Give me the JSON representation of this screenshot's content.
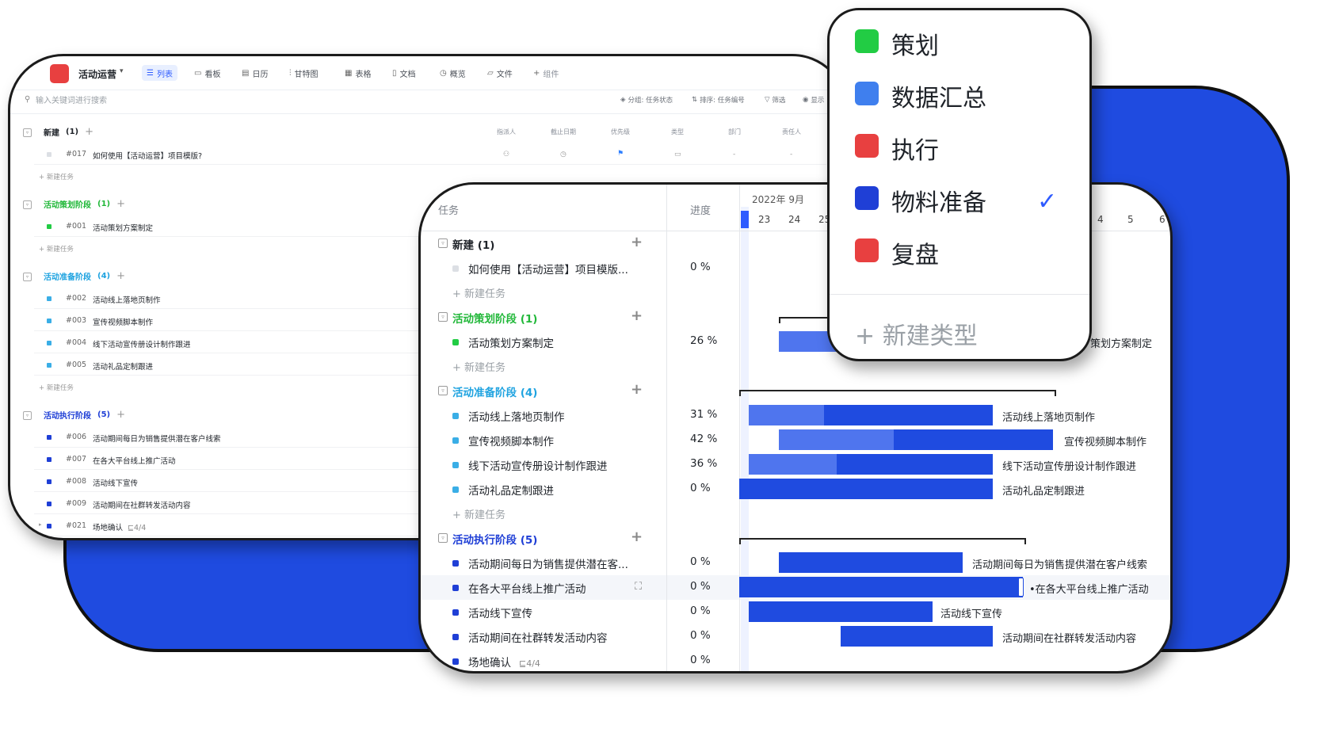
{
  "colors": {
    "brand_blue": "#1f4be0",
    "accent": "#2e5bff",
    "green": "#22cc44",
    "red": "#e84040",
    "light_blue": "#3f7fee",
    "cyan": "#3aaee6",
    "navy": "#1f3fd6"
  },
  "list_window": {
    "app_name": "活动运营",
    "tabs": [
      {
        "icon": "list-icon",
        "label": "列表"
      },
      {
        "icon": "kanban-icon",
        "label": "看板"
      },
      {
        "icon": "calendar-icon",
        "label": "日历"
      },
      {
        "icon": "gantt-icon",
        "label": "甘特图"
      },
      {
        "icon": "table-icon",
        "label": "表格"
      },
      {
        "icon": "doc-icon",
        "label": "文档"
      },
      {
        "icon": "overview-icon",
        "label": "概览"
      },
      {
        "icon": "folder-icon",
        "label": "文件"
      },
      {
        "icon": "plus-icon",
        "label": "组件"
      }
    ],
    "search_placeholder": "输入关键词进行搜索",
    "options": {
      "group": "分组: 任务状态",
      "sort": "排序: 任务编号",
      "filter": "筛选",
      "display": "显示"
    },
    "columns": [
      "指派人",
      "截止日期",
      "优先级",
      "类型",
      "部门",
      "责任人"
    ],
    "new_task_label": "新建任务",
    "groups": [
      {
        "name": "新建",
        "count": "(1)",
        "color": "#1f2329",
        "tasks": [
          {
            "id": "#017",
            "title": "如何使用【活动运营】项目模版?",
            "color": "#dcdfe4",
            "dept": "-",
            "owner": "-"
          }
        ]
      },
      {
        "name": "活动策划阶段",
        "count": "(1)",
        "color": "#22b83a",
        "tasks": [
          {
            "id": "#001",
            "title": "活动策划方案制定",
            "color": "#22cc44"
          }
        ]
      },
      {
        "name": "活动准备阶段",
        "count": "(4)",
        "color": "#1fa3e0",
        "tasks": [
          {
            "id": "#002",
            "title": "活动线上落地页制作",
            "color": "#3aaee6"
          },
          {
            "id": "#003",
            "title": "宣传视频脚本制作",
            "color": "#3aaee6"
          },
          {
            "id": "#004",
            "title": "线下活动宣传册设计制作跟进",
            "color": "#3aaee6"
          },
          {
            "id": "#005",
            "title": "活动礼品定制跟进",
            "color": "#3aaee6"
          }
        ]
      },
      {
        "name": "活动执行阶段",
        "count": "(5)",
        "color": "#1f3fd6",
        "tasks": [
          {
            "id": "#006",
            "title": "活动期间每日为销售提供潜在客户线索",
            "color": "#1f3fd6"
          },
          {
            "id": "#007",
            "title": "在各大平台线上推广活动",
            "color": "#1f3fd6"
          },
          {
            "id": "#008",
            "title": "活动线下宣传",
            "color": "#1f3fd6"
          },
          {
            "id": "#009",
            "title": "活动期间在社群转发活动内容",
            "color": "#1f3fd6"
          },
          {
            "id": "#021",
            "title": "场地确认",
            "subtasks": "⊑4/4",
            "color": "#1f3fd6"
          }
        ]
      }
    ]
  },
  "gantt_window": {
    "task_header": "任务",
    "progress_header": "进度",
    "month": "2022年 9月",
    "days_left": [
      "23",
      "24",
      "25"
    ],
    "days_right": [
      "4",
      "5",
      "6"
    ],
    "new_task_label": "新建任务",
    "rows": [
      {
        "kind": "group",
        "name": "新建",
        "count": "(1)",
        "color": "#1f2329"
      },
      {
        "kind": "task",
        "title": "如何使用【活动运营】项目模版...",
        "pct": "0 %",
        "color": "#dcdfe4"
      },
      {
        "kind": "new"
      },
      {
        "kind": "group",
        "name": "活动策划阶段",
        "count": "(1)",
        "color": "#22b83a"
      },
      {
        "kind": "task",
        "title": "活动策划方案制定",
        "pct": "26 %",
        "color": "#22cc44"
      },
      {
        "kind": "new"
      },
      {
        "kind": "group",
        "name": "活动准备阶段",
        "count": "(4)",
        "color": "#1fa3e0"
      },
      {
        "kind": "task",
        "title": "活动线上落地页制作",
        "pct": "31 %",
        "color": "#3aaee6"
      },
      {
        "kind": "task",
        "title": "宣传视频脚本制作",
        "pct": "42 %",
        "color": "#3aaee6"
      },
      {
        "kind": "task",
        "title": "线下活动宣传册设计制作跟进",
        "pct": "36 %",
        "color": "#3aaee6"
      },
      {
        "kind": "task",
        "title": "活动礼品定制跟进",
        "pct": "0 %",
        "color": "#3aaee6"
      },
      {
        "kind": "new"
      },
      {
        "kind": "group",
        "name": "活动执行阶段",
        "count": "(5)",
        "color": "#1f3fd6"
      },
      {
        "kind": "task",
        "title": "活动期间每日为销售提供潜在客...",
        "pct": "0 %",
        "color": "#1f3fd6"
      },
      {
        "kind": "task",
        "title": "在各大平台线上推广活动",
        "pct": "0 %",
        "color": "#1f3fd6"
      },
      {
        "kind": "task",
        "title": "活动线下宣传",
        "pct": "0 %",
        "color": "#1f3fd6"
      },
      {
        "kind": "task",
        "title": "活动期间在社群转发活动内容",
        "pct": "0 %",
        "color": "#1f3fd6"
      },
      {
        "kind": "task",
        "title": "场地确认",
        "sub": "⊑4/4",
        "pct": "0 %",
        "color": "#1f3fd6"
      }
    ],
    "bar_labels": {
      "plan": "策划方案制定",
      "landing": "活动线上落地页制作",
      "video": "宣传视频脚本制作",
      "brochure": "线下活动宣传册设计制作跟进",
      "gift": "活动礼品定制跟进",
      "leads": "活动期间每日为销售提供潜在客户线索",
      "promo": "在各大平台线上推广活动",
      "offline": "活动线下宣传",
      "community": "活动期间在社群转发活动内容"
    }
  },
  "type_dropdown": {
    "items": [
      {
        "label": "策划",
        "color": "#22cc44",
        "selected": false
      },
      {
        "label": "数据汇总",
        "color": "#3f7fee",
        "selected": false
      },
      {
        "label": "执行",
        "color": "#e84040",
        "selected": false
      },
      {
        "label": "物料准备",
        "color": "#1f3fd6",
        "selected": true
      },
      {
        "label": "复盘",
        "color": "#e84040",
        "selected": false
      }
    ],
    "check": "✓",
    "new_type_label": "新建类型"
  }
}
